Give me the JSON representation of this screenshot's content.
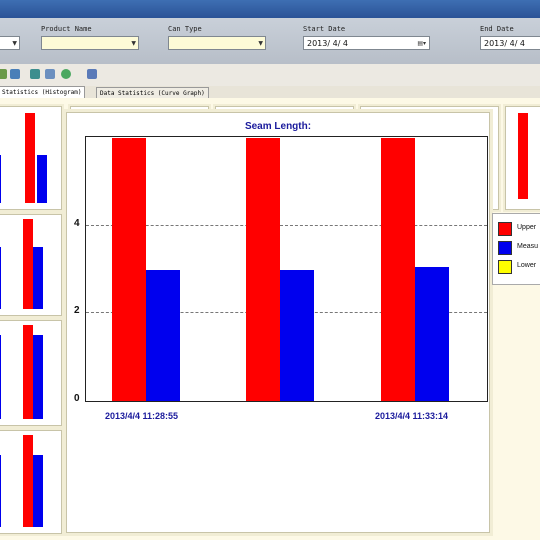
{
  "window": {
    "title": ""
  },
  "filters": {
    "product_name_label": "Product Name",
    "product_name_value": "",
    "can_type_label": "Can Type",
    "can_type_value": "",
    "start_date_label": "Start Date",
    "start_date_value": "2013/ 4/ 4",
    "end_date_label": "End Date",
    "end_date_value": "2013/ 4/ 4"
  },
  "tabs": [
    {
      "label": "Statistics (Histogram)",
      "active": true
    },
    {
      "label": "Data Statistics (Curve Graph)",
      "active": false
    }
  ],
  "colors": {
    "upper": "#ff0000",
    "measured": "#0000ee",
    "lower": "#ffff00",
    "title": "#1a1a9c"
  },
  "legend": {
    "upper": "Upper",
    "measured": "Measu",
    "lower": "Lower"
  },
  "chart_data": {
    "type": "bar",
    "title": "Seam Length:",
    "xlabel": "",
    "ylabel": "",
    "categories": [
      "2013/4/4 11:28:55",
      "",
      "2013/4/4 11:33:14"
    ],
    "x_tick_labels": [
      "2013/4/4 11:28:55",
      "2013/4/4 11:33:14"
    ],
    "y_ticks": [
      "0",
      "2",
      "4"
    ],
    "ylim": [
      0,
      6.0
    ],
    "grid": true,
    "legend_position": "right",
    "series": [
      {
        "name": "Upper",
        "color": "#ff0000",
        "values": [
          6.0,
          6.0,
          6.0
        ]
      },
      {
        "name": "Measu",
        "color": "#0000ee",
        "values": [
          3.0,
          3.0,
          3.05
        ]
      }
    ]
  }
}
